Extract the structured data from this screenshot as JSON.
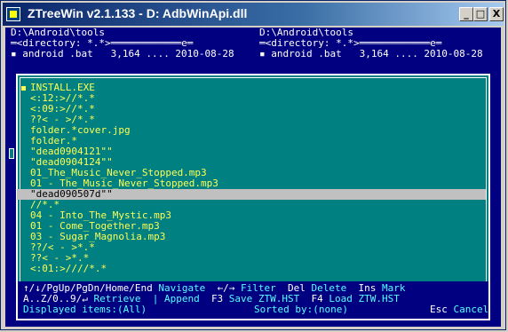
{
  "window": {
    "title": "ZTreeWin v2.1.133 - D: AdbWinApi.dll",
    "minimize": "_",
    "maximize": "□",
    "close": "X"
  },
  "panels": {
    "left": {
      "path": "D:\\Android\\tools",
      "filter": "<directory: *.*>",
      "file_line": "android .bat   3,164 .... 2010-08-28"
    },
    "right": {
      "path": "D:\\Android\\tools",
      "filter": "<directory: *.*>",
      "file_line": "android .bat   3,164 .... 2010-08-28"
    }
  },
  "history_list": {
    "items": [
      "INSTALL.EXE",
      "<:12:>//*.*",
      "<:09:>//*.*",
      "??< - >/*.*",
      "folder.*cover.jpg",
      "folder.*",
      "\"dead0904121\"\"",
      "\"dead0904124\"\"",
      "01_The_Music_Never_Stopped.mp3",
      "01 - The_Music_Never_Stopped.mp3",
      "\"dead090507d\"\"",
      "//*.*",
      "04 - Into_The_Mystic.mp3",
      "01 - Come_Together.mp3",
      "03 - Sugar_Magnolia.mp3",
      "??/< - >*.*",
      "??< - >*.*",
      "<:01:>////*.*"
    ],
    "selected_index": 10
  },
  "footer": {
    "row1": [
      {
        "k": "↑/↓/PgUp/PgDn/Home/End",
        "d": " Navigate  "
      },
      {
        "k": "←/→",
        "d": " Filter  "
      },
      {
        "k": "Del",
        "d": " Delete  "
      },
      {
        "k": "Ins",
        "d": " Mark"
      }
    ],
    "row2": [
      {
        "k": "A..Z/0..9/↵",
        "d": " Retrieve  | Append  "
      },
      {
        "k": "F3",
        "d": " Save ZTW.HST  "
      },
      {
        "k": "F4",
        "d": " Load ZTW.HST"
      }
    ],
    "displayed": "Displayed items:(All)",
    "sorted": "Sorted by:(none)",
    "esc_key": "Esc",
    "esc_label": " Cancel"
  },
  "colors": {
    "background": "#000080",
    "dialog": "#008080",
    "highlight": "#ffff55",
    "selection": "#c0c0c0"
  }
}
